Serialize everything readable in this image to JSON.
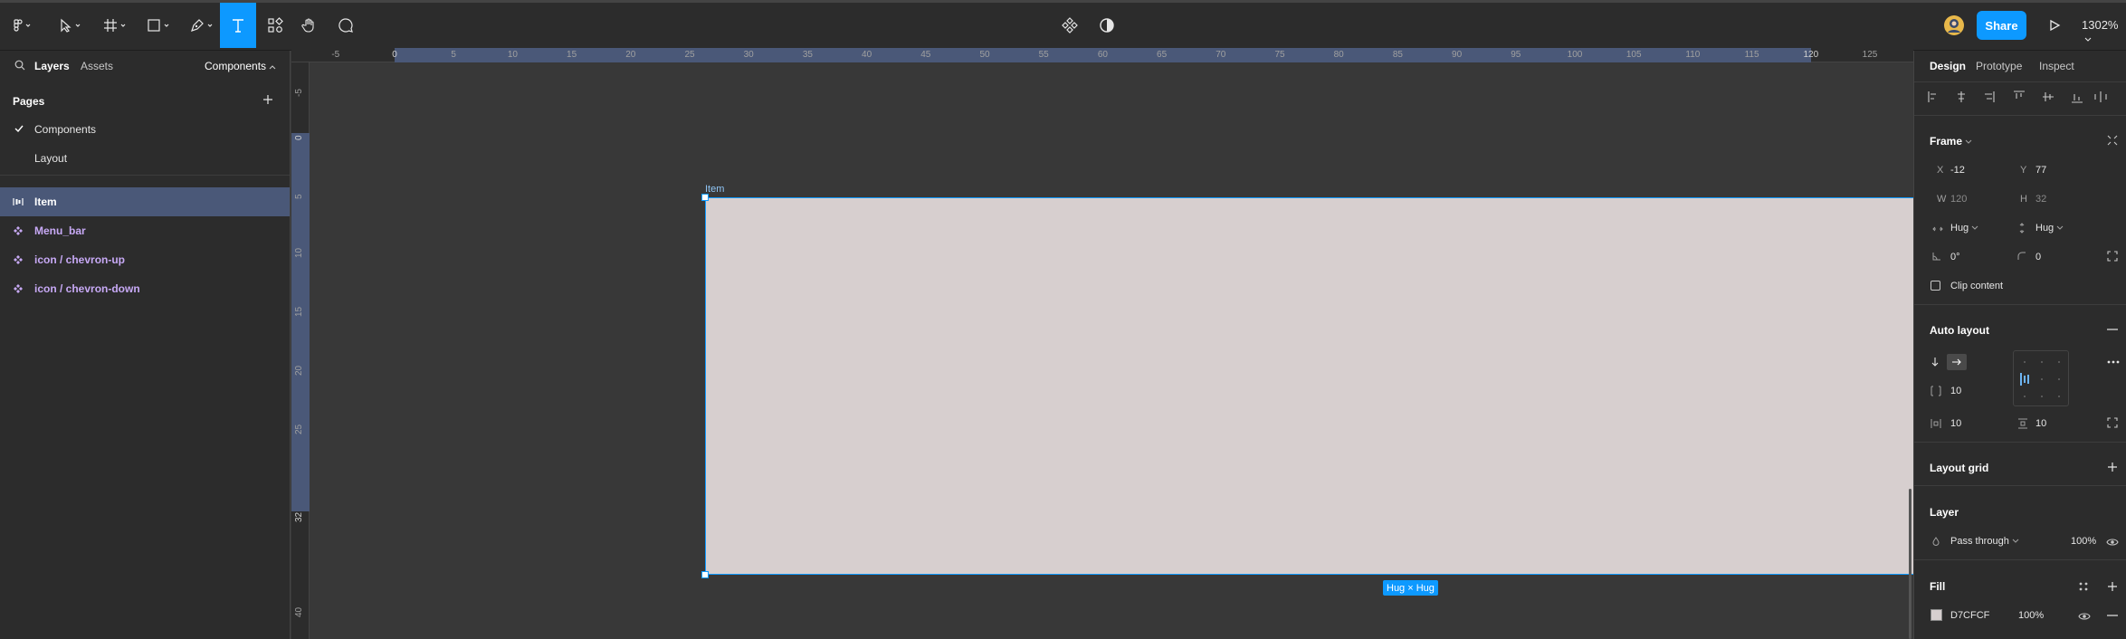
{
  "toolbar": {
    "share_label": "Share",
    "zoom_label": "1302%"
  },
  "left_panel": {
    "tabs": {
      "layers": "Layers",
      "assets": "Assets",
      "components": "Components"
    },
    "pages_title": "Pages",
    "pages": [
      {
        "label": "Components",
        "current": true
      },
      {
        "label": "Layout",
        "current": false
      }
    ],
    "layers": [
      {
        "label": "Item",
        "type": "frame",
        "selected": true
      },
      {
        "label": "Menu_bar",
        "type": "component",
        "selected": false
      },
      {
        "label": "icon / chevron-up",
        "type": "component",
        "selected": false
      },
      {
        "label": "icon / chevron-down",
        "type": "component",
        "selected": false
      }
    ]
  },
  "ruler": {
    "top_ticks": [
      "-5",
      "0",
      "5",
      "10",
      "15",
      "20",
      "25",
      "30",
      "35",
      "40",
      "45",
      "50",
      "55",
      "60",
      "65",
      "70",
      "75",
      "80",
      "85",
      "90",
      "95",
      "100",
      "105",
      "110",
      "115",
      "120",
      "125"
    ],
    "left_ticks": [
      "-5",
      "0",
      "5",
      "10",
      "15",
      "20",
      "25",
      "32",
      "40"
    ]
  },
  "canvas": {
    "frame_name": "Item",
    "frame_fill": "#D7CFCF",
    "size_badge": "Hug × Hug"
  },
  "right_panel": {
    "tabs": {
      "design": "Design",
      "prototype": "Prototype",
      "inspect": "Inspect"
    },
    "frame": {
      "title": "Frame",
      "x_label": "X",
      "x_value": "-12",
      "y_label": "Y",
      "y_value": "77",
      "w_label": "W",
      "w_value": "120",
      "h_label": "H",
      "h_value": "32",
      "horizontal_resizing": "Hug",
      "vertical_resizing": "Hug",
      "rotation": "0°",
      "corner_radius": "0",
      "clip_content_label": "Clip content"
    },
    "auto_layout": {
      "title": "Auto layout",
      "spacing": "10",
      "padding_horizontal": "10",
      "padding_vertical": "10"
    },
    "layout_grid": {
      "title": "Layout grid"
    },
    "layer": {
      "title": "Layer",
      "blend_mode": "Pass through",
      "opacity": "100%"
    },
    "fill": {
      "title": "Fill",
      "hex": "D7CFCF",
      "opacity": "100%",
      "swatch_color": "#D7CFCF"
    }
  },
  "colors": {
    "accent": "#0d99ff",
    "selection_row": "#4a5878",
    "component_text": "#c7a9f5"
  }
}
